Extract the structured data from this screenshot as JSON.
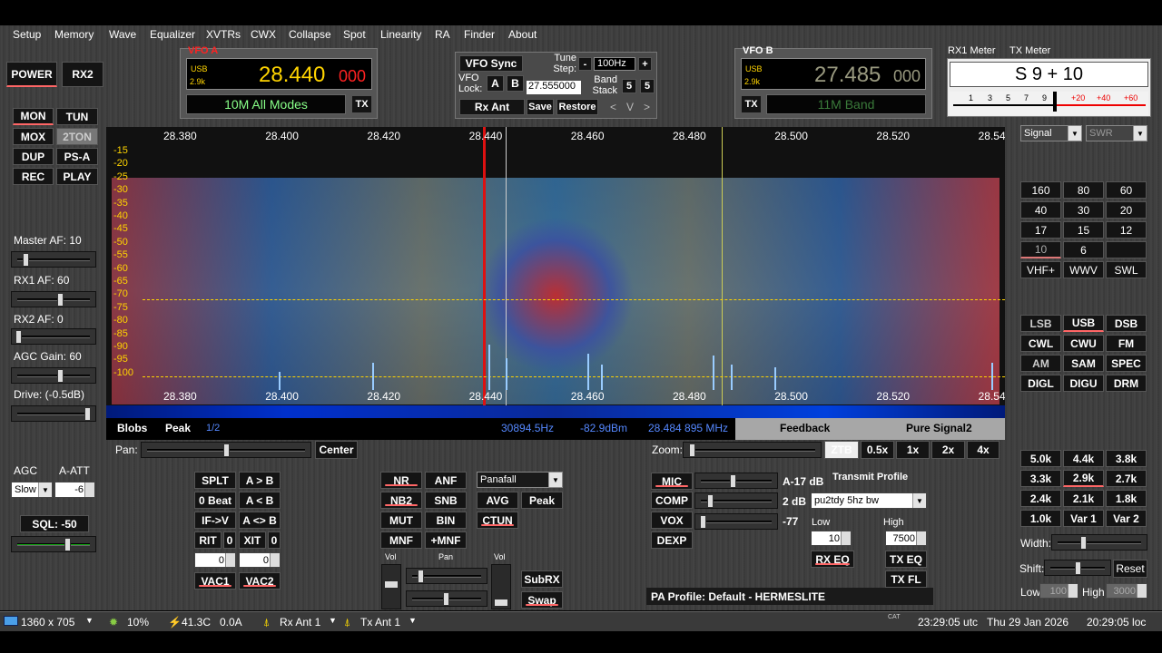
{
  "menu": [
    "Setup",
    "Memory",
    "Wave",
    "Equalizer",
    "XVTRs",
    "CWX",
    "Collapse",
    "Spot",
    "Linearity",
    "RA",
    "Finder",
    "About"
  ],
  "left_buttons": {
    "power": "POWER",
    "rx2": "RX2",
    "mon": "MON",
    "tun": "TUN",
    "mox": "MOX",
    "2ton": "2TON",
    "dup": "DUP",
    "psa": "PS-A",
    "rec": "REC",
    "play": "PLAY"
  },
  "left_sliders": {
    "master_af": "Master AF:  10",
    "rx1_af": "RX1 AF:  60",
    "rx2_af": "RX2 AF:  0",
    "agc_gain": "AGC Gain:  60",
    "drive": "Drive:  (-0.5dB)",
    "master_af_level": 0.1,
    "rx1_af_level": 0.6,
    "rx2_af_level": 0.0,
    "agc_gain_level": 0.6,
    "drive_level": 1.0
  },
  "agc": {
    "agc_label": "AGC",
    "aatt_label": "A-ATT",
    "agc_value": "Slow",
    "aatt_value": "-6",
    "sql": "SQL:  -50"
  },
  "vfo_a": {
    "title": "VFO A",
    "mode": "USB",
    "bw": "2.9k",
    "freq_main": "28.440",
    "freq_sub": "000",
    "band": "10M All Modes",
    "tx": "TX"
  },
  "vfo_sync": {
    "sync": "VFO Sync",
    "tune_step_label": "Tune Step:",
    "tune_step": "100Hz",
    "minus": "-",
    "plus": "+",
    "vfo_lock": "VFO Lock:",
    "a": "A",
    "b": "B",
    "lock_freq": "27.555000",
    "band_stack": "Band Stack",
    "bs5a": "5",
    "bs5b": "5",
    "rx_ant": "Rx Ant",
    "save": "Save",
    "restore": "Restore",
    "lt": "<",
    "v": "V",
    "gt": ">"
  },
  "vfo_b": {
    "title": "VFO B",
    "mode": "USB",
    "bw": "2.9k",
    "freq_main": "27.485",
    "freq_sub": "000",
    "band": "11M Band",
    "tx": "TX"
  },
  "meter": {
    "rx1": "RX1 Meter",
    "tx": "TX Meter",
    "reading": "S 9 + 10",
    "scale": [
      "1",
      "3",
      "5",
      "7",
      "9",
      "+20",
      "+40",
      "+60"
    ],
    "rx_sel": "Signal",
    "tx_sel": "SWR"
  },
  "bands": [
    "160",
    "80",
    "60",
    "40",
    "30",
    "20",
    "17",
    "15",
    "12",
    "10",
    "6",
    "",
    "VHF+",
    "WWV",
    "SWL"
  ],
  "modes": [
    "LSB",
    "USB",
    "DSB",
    "CWL",
    "CWU",
    "FM",
    "AM",
    "SAM",
    "SPEC",
    "DIGL",
    "DIGU",
    "DRM"
  ],
  "filters": [
    "5.0k",
    "4.4k",
    "3.8k",
    "3.3k",
    "2.9k",
    "2.7k",
    "2.4k",
    "2.1k",
    "1.8k",
    "1.0k",
    "Var 1",
    "Var 2"
  ],
  "filter_controls": {
    "width": "Width:",
    "shift": "Shift:",
    "reset": "Reset",
    "low": "Low",
    "low_val": "100",
    "high": "High",
    "high_val": "3000"
  },
  "spectrum": {
    "x_ticks": [
      "28.380",
      "28.400",
      "28.420",
      "28.440",
      "28.460",
      "28.480",
      "28.500",
      "28.520",
      "28.54"
    ],
    "y_ticks": [
      "-15",
      "-20",
      "-25",
      "-30",
      "-35",
      "-40",
      "-45",
      "-50",
      "-55",
      "-60",
      "-65",
      "-70",
      "-75",
      "-80",
      "-85",
      "-90",
      "-95",
      "-100"
    ],
    "blobs": "Blobs",
    "peak": "Peak",
    "peak_ratio": "1/2",
    "cursor_hz": "30894.5Hz",
    "cursor_dbm": "-82.9dBm",
    "cursor_freq": "28.484 895 MHz",
    "feedback": "Feedback",
    "pure_signal": "Pure Signal2"
  },
  "pan_zoom": {
    "pan": "Pan:",
    "center": "Center",
    "zoom": "Zoom:",
    "z_ztb": "ZTB",
    "z05": "0.5x",
    "z1": "1x",
    "z2": "2x",
    "z4": "4x"
  },
  "dsp_left": {
    "splt": "SPLT",
    "atob": "A > B",
    "zero_beat": "0 Beat",
    "altb": "A < B",
    "ifv": "IF->V",
    "aswapb": "A <> B",
    "rit": "RIT",
    "rit_val": "0",
    "xit": "XIT",
    "xit_val": "0",
    "rit_spin": "0",
    "xit_spin": "0",
    "vac1": "VAC1",
    "vac2": "VAC2"
  },
  "dsp_mid": {
    "nr": "NR",
    "anf": "ANF",
    "nb2": "NB2",
    "snb": "SNB",
    "mut": "MUT",
    "bin": "BIN",
    "mnf": "MNF",
    "pmnf": "+MNF",
    "display": "Panafall",
    "avg": "AVG",
    "peak": "Peak",
    "ctun": "CTUN",
    "vol": "Vol",
    "pan": "Pan",
    "vol2": "Vol",
    "subrx": "SubRX",
    "swap": "Swap"
  },
  "tx_panel": {
    "mic": "MIC",
    "mic_val": "A-17 dB",
    "comp": "COMP",
    "comp_val": "2 dB",
    "vox": "VOX",
    "vox_val": "-77",
    "dexp": "DEXP",
    "profile_label": "Transmit Profile",
    "profile": "pu2tdy 5hz bw",
    "low": "Low",
    "low_val": "10",
    "high": "High",
    "high_val": "7500",
    "rx_eq": "RX EQ",
    "tx_eq": "TX EQ",
    "tx_fl": "TX FL",
    "pa_profile": "PA Profile: Default - HERMESLITE"
  },
  "status": {
    "res": "1360 x 705",
    "cpu": "10%",
    "temp": "41.3C",
    "amps": "0.0A",
    "rx_ant": "Rx Ant  1",
    "tx_ant": "Tx Ant  1",
    "cat": "CAT",
    "utc": "23:29:05 utc",
    "date": "Thu 29 Jan 2026",
    "loc": "20:29:05 loc"
  }
}
